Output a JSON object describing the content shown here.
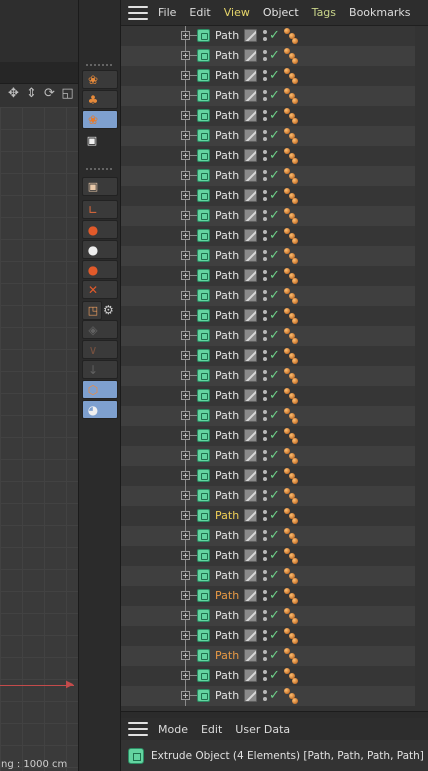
{
  "object_manager": {
    "menu": [
      "File",
      "Edit",
      "View",
      "Object",
      "Tags",
      "Bookmarks"
    ],
    "rows": [
      {
        "label": "Path",
        "style": "normal"
      },
      {
        "label": "Path",
        "style": "normal"
      },
      {
        "label": "Path",
        "style": "normal"
      },
      {
        "label": "Path",
        "style": "normal"
      },
      {
        "label": "Path",
        "style": "normal"
      },
      {
        "label": "Path",
        "style": "normal"
      },
      {
        "label": "Path",
        "style": "normal"
      },
      {
        "label": "Path",
        "style": "normal"
      },
      {
        "label": "Path",
        "style": "normal"
      },
      {
        "label": "Path",
        "style": "normal"
      },
      {
        "label": "Path",
        "style": "normal"
      },
      {
        "label": "Path",
        "style": "normal"
      },
      {
        "label": "Path",
        "style": "normal"
      },
      {
        "label": "Path",
        "style": "normal"
      },
      {
        "label": "Path",
        "style": "normal"
      },
      {
        "label": "Path",
        "style": "normal"
      },
      {
        "label": "Path",
        "style": "normal"
      },
      {
        "label": "Path",
        "style": "normal"
      },
      {
        "label": "Path",
        "style": "normal"
      },
      {
        "label": "Path",
        "style": "normal"
      },
      {
        "label": "Path",
        "style": "normal"
      },
      {
        "label": "Path",
        "style": "normal"
      },
      {
        "label": "Path",
        "style": "normal"
      },
      {
        "label": "Path",
        "style": "normal"
      },
      {
        "label": "Path",
        "style": "selected-yellow"
      },
      {
        "label": "Path",
        "style": "normal"
      },
      {
        "label": "Path",
        "style": "normal"
      },
      {
        "label": "Path",
        "style": "normal"
      },
      {
        "label": "Path",
        "style": "selected-orange"
      },
      {
        "label": "Path",
        "style": "normal"
      },
      {
        "label": "Path",
        "style": "normal"
      },
      {
        "label": "Path",
        "style": "selected-orange"
      },
      {
        "label": "Path",
        "style": "normal"
      },
      {
        "label": "Path",
        "style": "normal"
      }
    ]
  },
  "attribute_manager": {
    "menu": [
      "Mode",
      "Edit",
      "User Data"
    ],
    "title": "Extrude Object (4 Elements) [Path, Path, Path, Path]"
  },
  "viewport": {
    "scale_text": "ng : 1000 cm"
  },
  "colors": {
    "accent_yellow": "#f0d057",
    "accent_orange": "#e89a45",
    "spline_green": "#63d4a0",
    "check_green": "#6fd18a",
    "active_tool_blue": "#7ea0cf"
  },
  "icons": {
    "palette": [
      "spline-pen-icon",
      "sketch-icon",
      "spline-smooth-icon",
      "clapper-icon",
      "render-region-icon",
      "axis-icon",
      "point-select-icon",
      "move-point-icon",
      "rotate-point-icon",
      "delete-point-icon",
      "snap-icon",
      "settings-icon",
      "disabled-tool-icon",
      "disabled-tool-icon",
      "disabled-tool-icon",
      "generator-icon",
      "camera-icon"
    ]
  }
}
